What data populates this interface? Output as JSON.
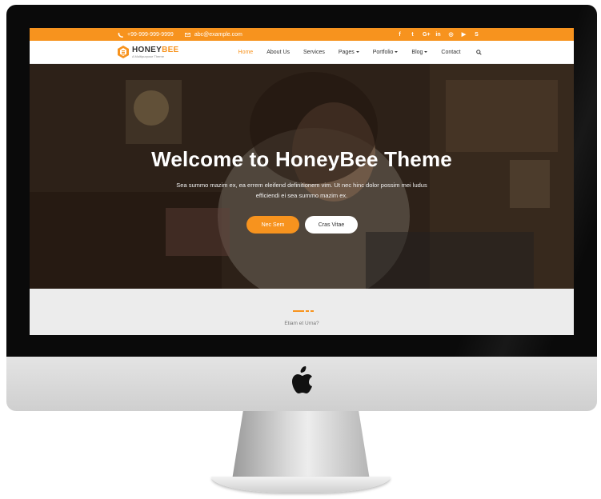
{
  "topbar": {
    "phone": "+99-999-999-9999",
    "email": "abc@example.com",
    "socials": [
      {
        "icon": "facebook-icon",
        "glyph": "f"
      },
      {
        "icon": "twitter-icon",
        "glyph": "t"
      },
      {
        "icon": "google-plus-icon",
        "glyph": "G+"
      },
      {
        "icon": "linkedin-icon",
        "glyph": "in"
      },
      {
        "icon": "instagram-icon",
        "glyph": "◎"
      },
      {
        "icon": "youtube-icon",
        "glyph": "▶"
      },
      {
        "icon": "skype-icon",
        "glyph": "S"
      }
    ]
  },
  "brand": {
    "name_part1": "HONEY",
    "name_part2": "BEE",
    "tagline": "A Multipurpose Theme"
  },
  "nav": {
    "items": [
      {
        "label": "Home",
        "active": true,
        "dropdown": false
      },
      {
        "label": "About Us",
        "active": false,
        "dropdown": false
      },
      {
        "label": "Services",
        "active": false,
        "dropdown": false
      },
      {
        "label": "Pages",
        "active": false,
        "dropdown": true
      },
      {
        "label": "Portfolio",
        "active": false,
        "dropdown": true
      },
      {
        "label": "Blog",
        "active": false,
        "dropdown": true
      },
      {
        "label": "Contact",
        "active": false,
        "dropdown": false
      }
    ]
  },
  "hero": {
    "title": "Welcome to HoneyBee Theme",
    "subtitle": "Sea summo mazim ex, ea errem eleifend definitionem vim. Ut nec hinc dolor possim mei ludus efficiendi ei sea summo mazim ex.",
    "primary_button": "Nec Sem",
    "secondary_button": "Cras Vitae"
  },
  "section": {
    "label": "Etiam et Urna?"
  },
  "colors": {
    "accent": "#f7931e",
    "bezel": "#0a0a0a"
  }
}
